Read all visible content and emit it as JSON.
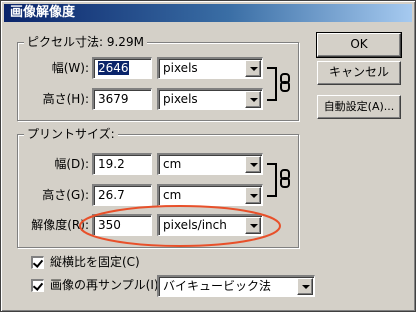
{
  "window": {
    "title": "画像解像度"
  },
  "pixel_size": {
    "legend": "ピクセル寸法: 9.29M",
    "width": {
      "label": "幅(W):",
      "value": "2646",
      "unit": "pixels"
    },
    "height": {
      "label": "高さ(H):",
      "value": "3679",
      "unit": "pixels"
    }
  },
  "print_size": {
    "legend": "プリントサイズ:",
    "width": {
      "label": "幅(D):",
      "value": "19.2",
      "unit": "cm"
    },
    "height": {
      "label": "高さ(G):",
      "value": "26.7",
      "unit": "cm"
    },
    "resolution": {
      "label": "解像度(R):",
      "value": "350",
      "unit": "pixels/inch"
    }
  },
  "options": {
    "constrain": {
      "label": "縦横比を固定(C)",
      "checked": true
    },
    "resample": {
      "label": "画像の再サンプル(I):",
      "checked": true,
      "method": "バイキュービック法"
    }
  },
  "buttons": {
    "ok": "OK",
    "cancel": "キャンセル",
    "auto": "自動設定(A)..."
  },
  "annotation": {
    "highlight_color": "#e8502a"
  }
}
